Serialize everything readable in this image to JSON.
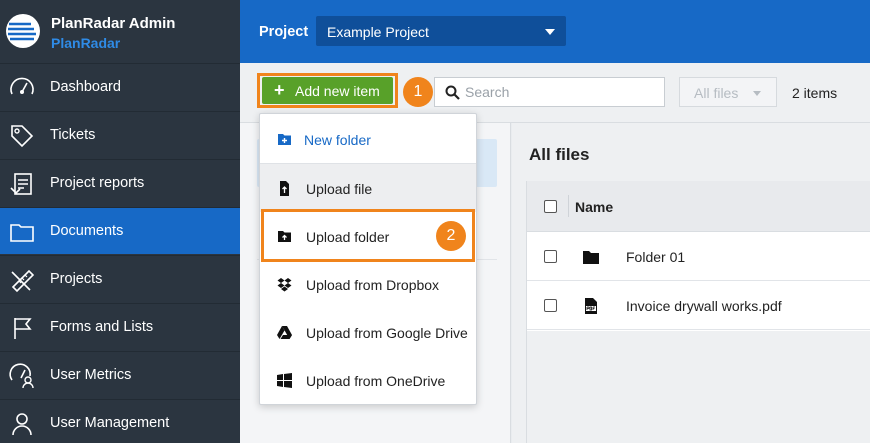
{
  "brand": {
    "title": "PlanRadar Admin",
    "subtitle": "PlanRadar"
  },
  "nav": [
    {
      "label": "Dashboard",
      "icon": "dashboard-gauge-icon"
    },
    {
      "label": "Tickets",
      "icon": "ticket-tag-icon"
    },
    {
      "label": "Project reports",
      "icon": "report-icon"
    },
    {
      "label": "Documents",
      "icon": "folder-icon",
      "active": true
    },
    {
      "label": "Projects",
      "icon": "projects-ruler-icon"
    },
    {
      "label": "Forms and Lists",
      "icon": "flag-icon"
    },
    {
      "label": "User Metrics",
      "icon": "user-metrics-icon"
    },
    {
      "label": "User Management",
      "icon": "user-management-icon"
    }
  ],
  "topbar": {
    "project_label": "Project",
    "project_value": "Example Project"
  },
  "toolbar": {
    "add_label": "Add new item",
    "step1": "1",
    "search_placeholder": "Search",
    "filter_value": "All files",
    "item_count": "2 items"
  },
  "main": {
    "title": "All files",
    "column_name": "Name",
    "rows": [
      {
        "name": "Folder 01",
        "icon": "folder-icon"
      },
      {
        "name": "Invoice drywall works.pdf",
        "icon": "pdf-file-icon"
      }
    ]
  },
  "menu": {
    "items": [
      {
        "label": "New folder",
        "icon": "new-folder-icon"
      },
      {
        "label": "Upload file",
        "icon": "upload-file-icon"
      },
      {
        "label": "Upload folder",
        "icon": "upload-folder-icon"
      },
      {
        "label": "Upload from Dropbox",
        "icon": "dropbox-icon"
      },
      {
        "label": "Upload from Google Drive",
        "icon": "google-drive-icon"
      },
      {
        "label": "Upload from OneDrive",
        "icon": "windows-icon"
      }
    ],
    "step2": "2"
  },
  "colors": {
    "sidebar": "#2b3540",
    "accent_blue": "#1769c6",
    "add_green": "#58a129",
    "highlight_orange": "#f0841c"
  }
}
